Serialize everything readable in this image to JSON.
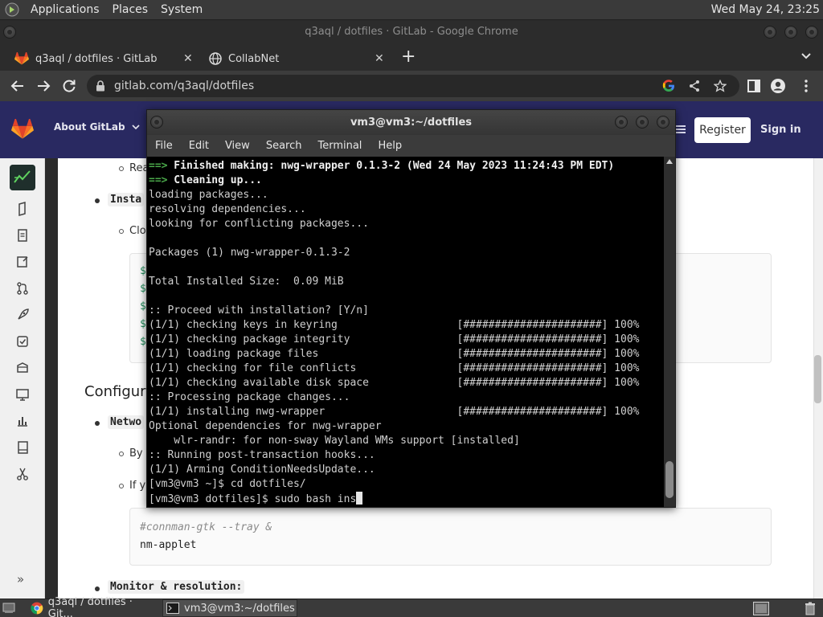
{
  "desktop": {
    "menu": [
      "Applications",
      "Places",
      "System"
    ],
    "clock": "Wed May 24, 23:25"
  },
  "chrome": {
    "window_title": "q3aql / dotfiles · GitLab - Google Chrome",
    "tabs": [
      {
        "label": "q3aql / dotfiles · GitLab",
        "icon": "gitlab-icon",
        "active": true
      },
      {
        "label": "CollabNet",
        "icon": "globe-icon",
        "active": false
      }
    ],
    "tab_close_glyph": "✕",
    "new_tab_glyph": "+",
    "url": "gitlab.com/q3aql/dotfiles"
  },
  "gitlab": {
    "about": "About GitLab",
    "register": "Register",
    "signin": "Sign in",
    "content": {
      "item_rea": "Rea",
      "item_insta": "Insta",
      "item_clo": "Clo",
      "heading_configura": "Configura",
      "item_netwo": "Netwo",
      "item_by": "By",
      "item_if": "If y",
      "code_prompt": "$",
      "code_comment": "#connman-gtk --tray &",
      "code_cmd": "nm-applet",
      "monitor_label": "Monitor & resolution:"
    },
    "expand_glyph": "»"
  },
  "terminal": {
    "title": "vm3@vm3:~/dotfiles",
    "menu": [
      "File",
      "Edit",
      "View",
      "Search",
      "Terminal",
      "Help"
    ],
    "lines": [
      {
        "arrow": "==>",
        "text": " Finished making: nwg-wrapper 0.1.3-2 (Wed 24 May 2023 11:24:43 PM EDT)"
      },
      {
        "arrow": "==>",
        "text": " Cleaning up..."
      },
      {
        "text": "loading packages..."
      },
      {
        "text": "resolving dependencies..."
      },
      {
        "text": "looking for conflicting packages..."
      },
      {
        "text": ""
      },
      {
        "text": "Packages (1) nwg-wrapper-0.1.3-2"
      },
      {
        "text": ""
      },
      {
        "text": "Total Installed Size:  0.09 MiB"
      },
      {
        "text": ""
      },
      {
        "text": ":: Proceed with installation? [Y/n]"
      },
      {
        "text": "(1/1) checking keys in keyring                   [######################] 100%"
      },
      {
        "text": "(1/1) checking package integrity                 [######################] 100%"
      },
      {
        "text": "(1/1) loading package files                      [######################] 100%"
      },
      {
        "text": "(1/1) checking for file conflicts                [######################] 100%"
      },
      {
        "text": "(1/1) checking available disk space              [######################] 100%"
      },
      {
        "text": ":: Processing package changes..."
      },
      {
        "text": "(1/1) installing nwg-wrapper                     [######################] 100%"
      },
      {
        "text": "Optional dependencies for nwg-wrapper"
      },
      {
        "text": "    wlr-randr: for non-sway Wayland WMs support [installed]"
      },
      {
        "text": ":: Running post-transaction hooks..."
      },
      {
        "text": "(1/1) Arming ConditionNeedsUpdate..."
      },
      {
        "text": "[vm3@vm3 ~]$ cd dotfiles/"
      },
      {
        "text": "[vm3@vm3 dotfiles]$ sudo bash ins",
        "cursor": true
      }
    ]
  },
  "taskbar": {
    "tasks": [
      {
        "label": "q3aql / dotfiles · Git...",
        "icon": "chrome-icon"
      },
      {
        "label": "vm3@vm3:~/dotfiles",
        "icon": "terminal-icon"
      }
    ]
  },
  "colors": {
    "gitlab_header": "#292961",
    "terminal_bg": "#000000",
    "prompt_arrow": "#4aa84a",
    "code_dollar": "#1f8a5a"
  }
}
